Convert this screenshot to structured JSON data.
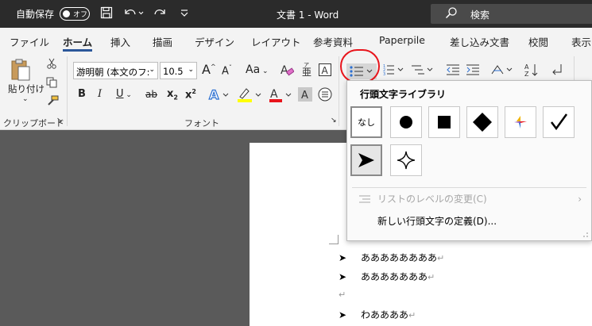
{
  "titlebar": {
    "autosave_label": "自動保存",
    "autosave_state": "オフ",
    "doc_title": "文書 1  -  Word",
    "search_placeholder": "検索",
    "save_icon": "save-icon",
    "undo_icon": "undo-icon",
    "redo_icon": "redo-icon",
    "customize_icon": "customize-qat-icon"
  },
  "tabs": [
    {
      "label": "ファイル"
    },
    {
      "label": "ホーム",
      "active": true
    },
    {
      "label": "挿入"
    },
    {
      "label": "描画"
    },
    {
      "label": "デザイン"
    },
    {
      "label": "レイアウト"
    },
    {
      "label": "参考資料"
    },
    {
      "label": "Paperpile"
    },
    {
      "label": "差し込み文書"
    },
    {
      "label": "校閲"
    },
    {
      "label": "表示"
    }
  ],
  "ribbon": {
    "clipboard": {
      "paste_label": "貼り付け",
      "group_label": "クリップボード"
    },
    "font": {
      "font_name": "游明朝 (本文のフ:",
      "font_size": "10.5",
      "grow_font": "A",
      "shrink_font": "A",
      "change_case": "Aa",
      "bold": "B",
      "italic": "I",
      "underline": "U",
      "strikethrough": "ab",
      "subscript": "x",
      "superscript": "x",
      "font_color_letter": "A",
      "char_shading": "A",
      "group_label": "フォント"
    },
    "accent_red": "#e8141b",
    "highlight_yellow": "#ffff00"
  },
  "bullet_library": {
    "header": "行頭文字ライブラリ",
    "none_label": "なし",
    "items": [
      "none",
      "filled-circle",
      "filled-square",
      "filled-diamond",
      "colorful-star",
      "checkmark",
      "arrowhead",
      "four-point-star"
    ],
    "menu": {
      "change_level": "リストのレベルの変更(C)",
      "define_new": "新しい行頭文字の定義(D)..."
    }
  },
  "document": {
    "lines": [
      {
        "bullet": "➤",
        "text": "ああああああああ",
        "mark": "↵"
      },
      {
        "bullet": "➤",
        "text": "あああああああ",
        "mark": "↵"
      },
      {
        "bullet": "",
        "text": "",
        "mark": "↵"
      },
      {
        "bullet": "➤",
        "text": "わああああ",
        "mark": "↵"
      }
    ]
  }
}
